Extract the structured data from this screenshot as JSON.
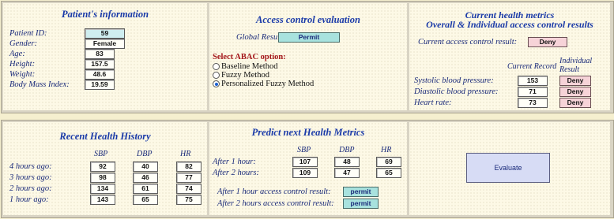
{
  "patient": {
    "title": "Patient's information",
    "fields": [
      {
        "label": "Patient ID:",
        "value": "59"
      },
      {
        "label": "Gender:",
        "value": "Female"
      },
      {
        "label": "Age:",
        "value": "83"
      },
      {
        "label": "Height:",
        "value": "157.5"
      },
      {
        "label": "Weight:",
        "value": "48.6"
      },
      {
        "label": "Body Mass Index:",
        "value": "19.59"
      }
    ]
  },
  "access": {
    "title": "Access control evaluation",
    "global_label": "Global Result:",
    "global_value": "Permit",
    "select_label": "Select ABAC option:",
    "options": [
      "Baseline Method",
      "Fuzzy Method",
      "Personalized Fuzzy Method"
    ],
    "selected_index": 2
  },
  "metrics": {
    "title1": "Current health metrics",
    "title2": "Overall & Individual access control results",
    "current_label": "Current access control result:",
    "current_value": "Deny",
    "col_record": "Current Record",
    "col_individual1": "Individual",
    "col_individual2": "Result",
    "rows": [
      {
        "label": "Systolic blood pressure:",
        "value": "153",
        "result": "Deny"
      },
      {
        "label": "Diastolic blood pressure:",
        "value": "71",
        "result": "Deny"
      },
      {
        "label": "Heart rate:",
        "value": "73",
        "result": "Deny"
      }
    ]
  },
  "history": {
    "title": "Recent Health History",
    "columns": [
      "SBP",
      "DBP",
      "HR"
    ],
    "rows": [
      {
        "label": "4 hours ago:",
        "values": [
          "92",
          "40",
          "82"
        ]
      },
      {
        "label": "3 hours ago:",
        "values": [
          "98",
          "46",
          "77"
        ]
      },
      {
        "label": "2 hours ago:",
        "values": [
          "134",
          "61",
          "74"
        ]
      },
      {
        "label": "1 hour ago:",
        "values": [
          "143",
          "65",
          "75"
        ]
      }
    ]
  },
  "predict": {
    "title": "Predict next Health Metrics",
    "columns": [
      "SBP",
      "DBP",
      "HR"
    ],
    "rows": [
      {
        "label": "After 1 hour:",
        "values": [
          "107",
          "48",
          "69"
        ]
      },
      {
        "label": "After 2 hours:",
        "values": [
          "109",
          "47",
          "65"
        ]
      }
    ],
    "result1_label": "After 1 hour access control result:",
    "result1_value": "permit",
    "result2_label": "After 2 hours access control result:",
    "result2_value": "permit"
  },
  "evaluate": {
    "button_label": "Evaluate"
  }
}
